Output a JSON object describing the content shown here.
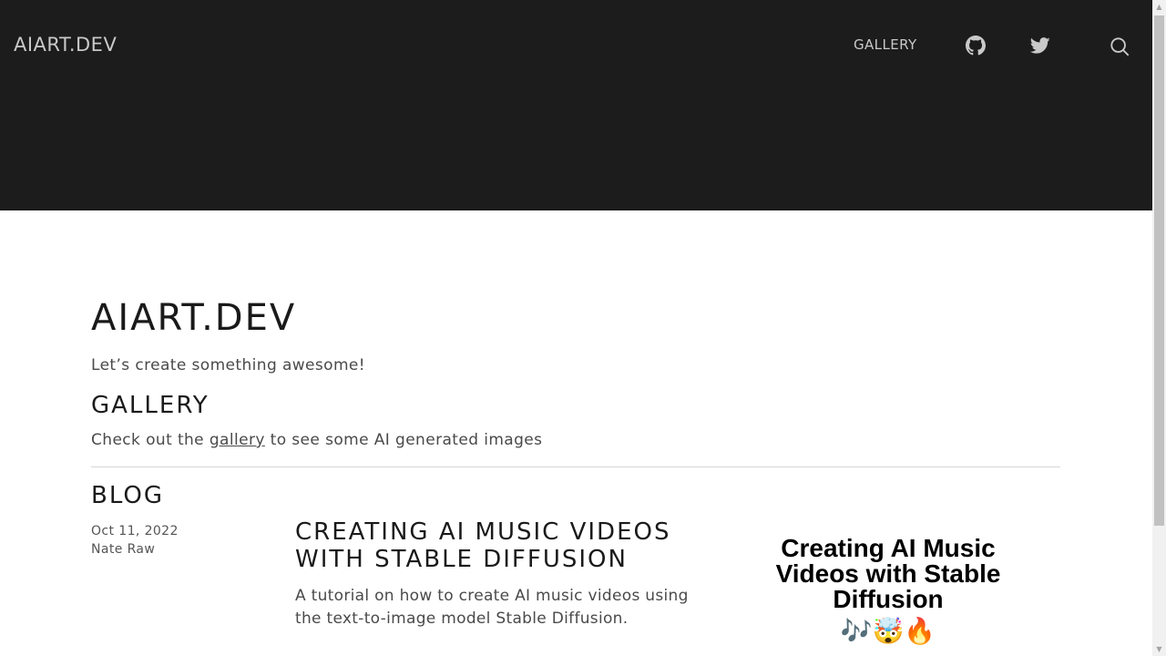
{
  "header": {
    "brand": "AIART.DEV",
    "nav": {
      "gallery_label": "GALLERY"
    },
    "icons": {
      "github": "github-icon",
      "twitter": "twitter-icon",
      "search": "search-icon"
    }
  },
  "main": {
    "title": "AIART.DEV",
    "tagline": "Let’s create something awesome!",
    "gallery": {
      "heading": "GALLERY",
      "text_before": "Check out the ",
      "link": "gallery",
      "text_after": " to see some AI generated images"
    },
    "blog": {
      "heading": "BLOG",
      "posts": [
        {
          "date": "Oct 11, 2022",
          "author": "Nate Raw",
          "title": "CREATING AI MUSIC VIDEOS WITH STABLE DIFFUSION",
          "description": "A tutorial on how to create AI music videos using the text-to-image model Stable Diffusion.",
          "thumbnail_text": "Creating AI Music Videos with Stable Diffusion",
          "thumbnail_emoji": "🎶🤯🔥"
        }
      ]
    }
  },
  "colors": {
    "header_bg": "#1c1c1c",
    "header_text": "#c9c9c9",
    "body_text": "#4a4a4a",
    "heading_text": "#1a1a1a"
  }
}
